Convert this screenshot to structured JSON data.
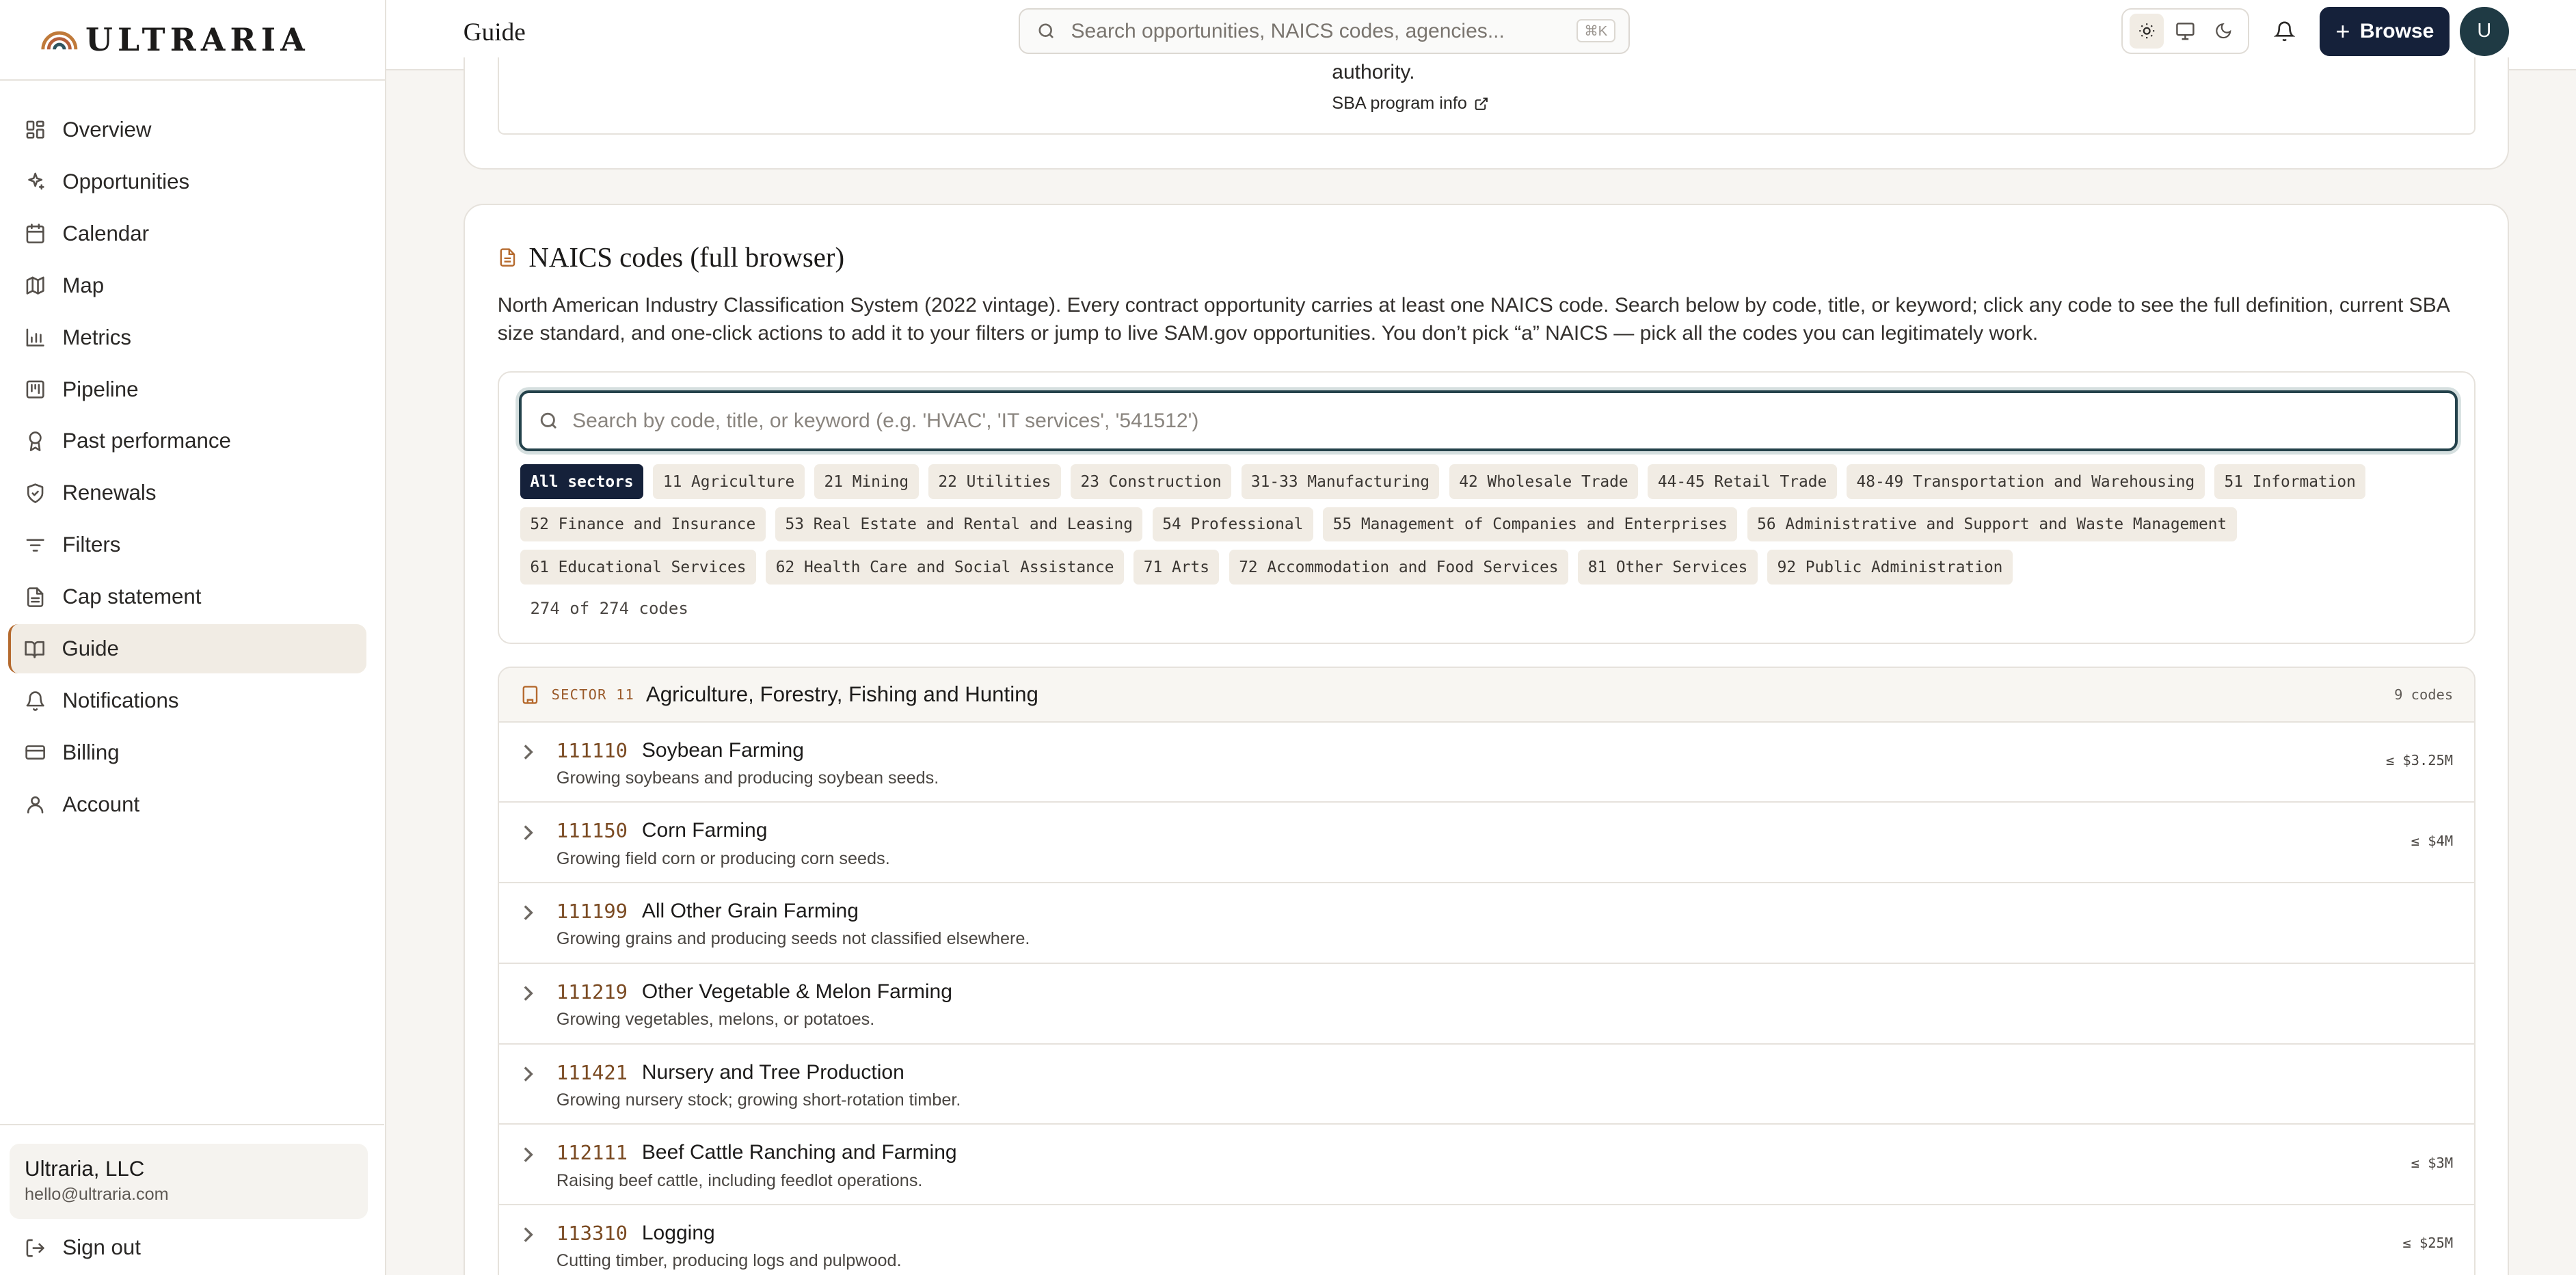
{
  "brand": {
    "name": "ULTRARIA"
  },
  "sidebar": {
    "items": [
      {
        "label": "Overview",
        "icon": "dashboard-icon"
      },
      {
        "label": "Opportunities",
        "icon": "sparkles-icon"
      },
      {
        "label": "Calendar",
        "icon": "calendar-icon"
      },
      {
        "label": "Map",
        "icon": "map-icon"
      },
      {
        "label": "Metrics",
        "icon": "bar-chart-icon"
      },
      {
        "label": "Pipeline",
        "icon": "kanban-icon"
      },
      {
        "label": "Past performance",
        "icon": "award-icon"
      },
      {
        "label": "Renewals",
        "icon": "shield-check-icon"
      },
      {
        "label": "Filters",
        "icon": "filter-lines-icon"
      },
      {
        "label": "Cap statement",
        "icon": "document-icon"
      },
      {
        "label": "Guide",
        "icon": "book-icon",
        "active": true
      },
      {
        "label": "Notifications",
        "icon": "bell-icon"
      },
      {
        "label": "Billing",
        "icon": "credit-card-icon"
      },
      {
        "label": "Account",
        "icon": "user-icon"
      }
    ],
    "org_name": "Ultraria, LLC",
    "org_email": "hello@ultraria.com",
    "signout_label": "Sign out"
  },
  "header": {
    "title": "Guide",
    "search_placeholder": "Search opportunities, NAICS codes, agencies...",
    "search_shortcut": "⌘K",
    "browse_label": "Browse",
    "avatar_initial": "U",
    "theme_selected": "light"
  },
  "top_card": {
    "authority_text": "authority.",
    "sba_link": "SBA program info"
  },
  "naics": {
    "title": "NAICS codes (full browser)",
    "description": "North American Industry Classification System (2022 vintage). Every contract opportunity carries at least one NAICS code. Search below by code, title, or keyword; click any code to see the full definition, current SBA size standard, and one-click actions to add it to your filters or jump to live SAM.gov opportunities. You don’t pick “a” NAICS — pick all the codes you can legitimately work.",
    "search_placeholder": "Search by code, title, or keyword (e.g. 'HVAC', 'IT services', '541512')",
    "chips": [
      "All sectors",
      "11 Agriculture",
      "21 Mining",
      "22 Utilities",
      "23 Construction",
      "31-33 Manufacturing",
      "42 Wholesale Trade",
      "44-45 Retail Trade",
      "48-49 Transportation and Warehousing",
      "51 Information",
      "52 Finance and Insurance",
      "53 Real Estate and Rental and Leasing",
      "54 Professional",
      "55 Management of Companies and Enterprises",
      "56 Administrative and Support and Waste Management",
      "61 Educational Services",
      "62 Health Care and Social Assistance",
      "71 Arts",
      "72 Accommodation and Food Services",
      "81 Other Services",
      "92 Public Administration"
    ],
    "selected_chip": "All sectors",
    "count_text": "274 of 274 codes",
    "sector": {
      "tag": "SECTOR 11",
      "name": "Agriculture, Forestry, Fishing and Hunting",
      "count": "9 codes"
    },
    "rows": [
      {
        "code": "111110",
        "title": "Soybean Farming",
        "desc": "Growing soybeans and producing soybean seeds.",
        "size": "≤ $3.25M"
      },
      {
        "code": "111150",
        "title": "Corn Farming",
        "desc": "Growing field corn or producing corn seeds.",
        "size": "≤ $4M"
      },
      {
        "code": "111199",
        "title": "All Other Grain Farming",
        "desc": "Growing grains and producing seeds not classified elsewhere.",
        "size": ""
      },
      {
        "code": "111219",
        "title": "Other Vegetable & Melon Farming",
        "desc": "Growing vegetables, melons, or potatoes.",
        "size": ""
      },
      {
        "code": "111421",
        "title": "Nursery and Tree Production",
        "desc": "Growing nursery stock; growing short-rotation timber.",
        "size": ""
      },
      {
        "code": "112111",
        "title": "Beef Cattle Ranching and Farming",
        "desc": "Raising beef cattle, including feedlot operations.",
        "size": "≤ $3M"
      },
      {
        "code": "113310",
        "title": "Logging",
        "desc": "Cutting timber, producing logs and pulpwood.",
        "size": "≤ $25M"
      }
    ]
  },
  "colors": {
    "accent": "#b56a2e",
    "navy": "#15213a",
    "teal": "#24424b"
  }
}
